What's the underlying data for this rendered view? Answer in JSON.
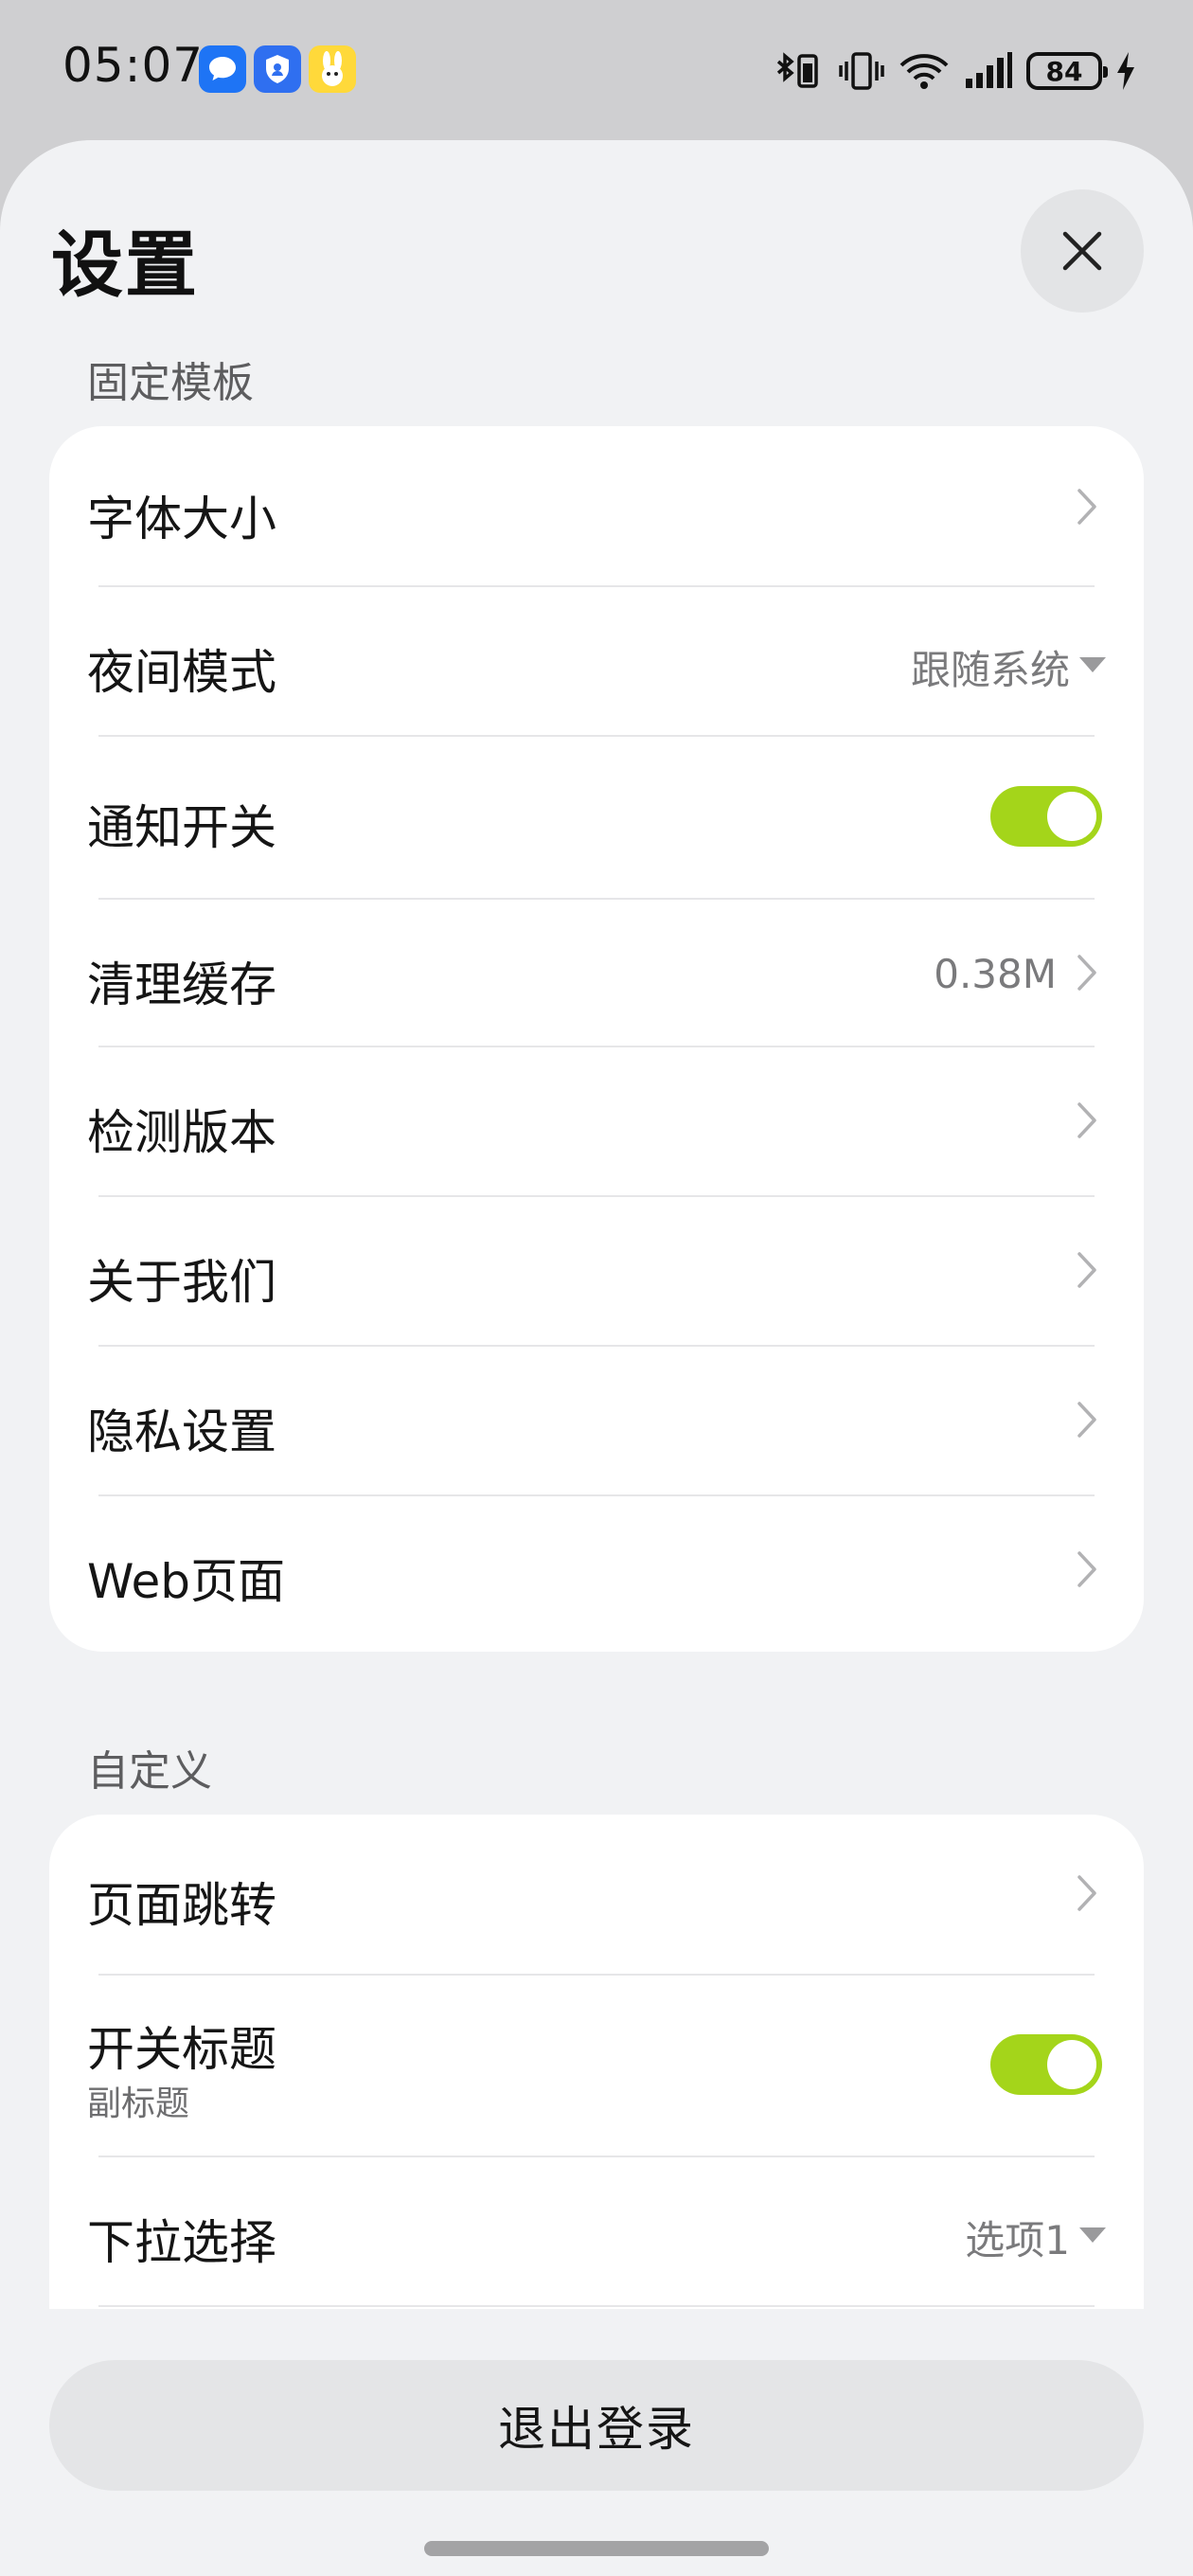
{
  "status_bar": {
    "time": "05:07",
    "battery": "84",
    "notification_icons": [
      "message-app-icon",
      "security-shield-app-icon",
      "yellow-rabbit-app-icon"
    ],
    "system_icons": [
      "bluetooth-battery-icon",
      "vibrate-icon",
      "wifi-icon",
      "cellular-signal-icon",
      "battery-icon",
      "charging-bolt-icon"
    ]
  },
  "header": {
    "title": "设置",
    "close_icon": "close-icon"
  },
  "sections": {
    "fixed": {
      "label": "固定模板",
      "rows": {
        "font_size": {
          "label": "字体大小"
        },
        "night_mode": {
          "label": "夜间模式",
          "value": "跟随系统"
        },
        "notification": {
          "label": "通知开关",
          "toggle_on": true
        },
        "clear_cache": {
          "label": "清理缓存",
          "value": "0.38M"
        },
        "check_version": {
          "label": "检测版本"
        },
        "about_us": {
          "label": "关于我们"
        },
        "privacy": {
          "label": "隐私设置"
        },
        "web_page": {
          "label": "Web页面"
        }
      }
    },
    "custom": {
      "label": "自定义",
      "rows": {
        "page_jump": {
          "label": "页面跳转"
        },
        "switch_title": {
          "label": "开关标题",
          "subtitle": "副标题",
          "toggle_on": true
        },
        "dropdown": {
          "label": "下拉选择",
          "value": "选项1"
        }
      }
    }
  },
  "footer": {
    "logout_label": "退出登录"
  },
  "colors": {
    "toggle_on": "#a4d51a",
    "sheet_bg": "#f1f2f4",
    "card_bg": "#ffffff",
    "button_bg": "#e4e5e7"
  }
}
